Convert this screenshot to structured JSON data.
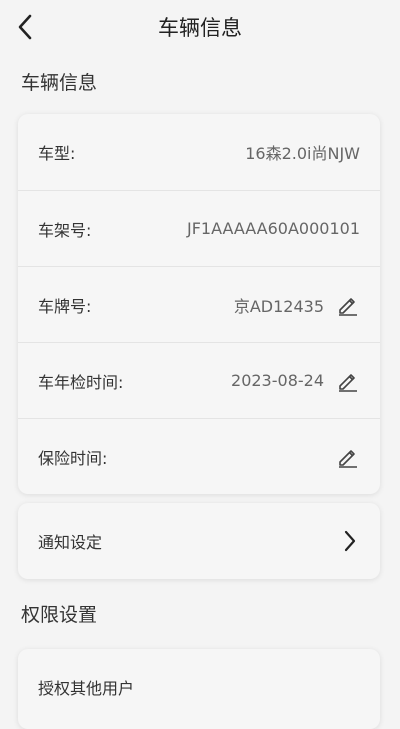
{
  "header": {
    "title": "车辆信息",
    "back_icon": "chevron-left-icon"
  },
  "sections": {
    "vehicle_title": "车辆信息",
    "permission_title": "权限设置"
  },
  "vehicle": {
    "rows": [
      {
        "label": "车型:",
        "value": "16森2.0i尚NJW",
        "editable": false
      },
      {
        "label": "车架号:",
        "value": "JF1AAAAA60A000101",
        "editable": false
      },
      {
        "label": "车牌号:",
        "value": "京AD12435",
        "editable": true
      },
      {
        "label": "车年检时间:",
        "value": "2023-08-24",
        "editable": true
      },
      {
        "label": "保险时间:",
        "value": "",
        "editable": true
      }
    ]
  },
  "notification": {
    "label": "通知设定",
    "icon": "chevron-right-icon"
  },
  "permission": {
    "authorize_label": "授权其他用户"
  },
  "colors": {
    "background": "#f4f4f4",
    "card": "#f6f6f6",
    "text": "#333333",
    "muted": "#666666"
  }
}
